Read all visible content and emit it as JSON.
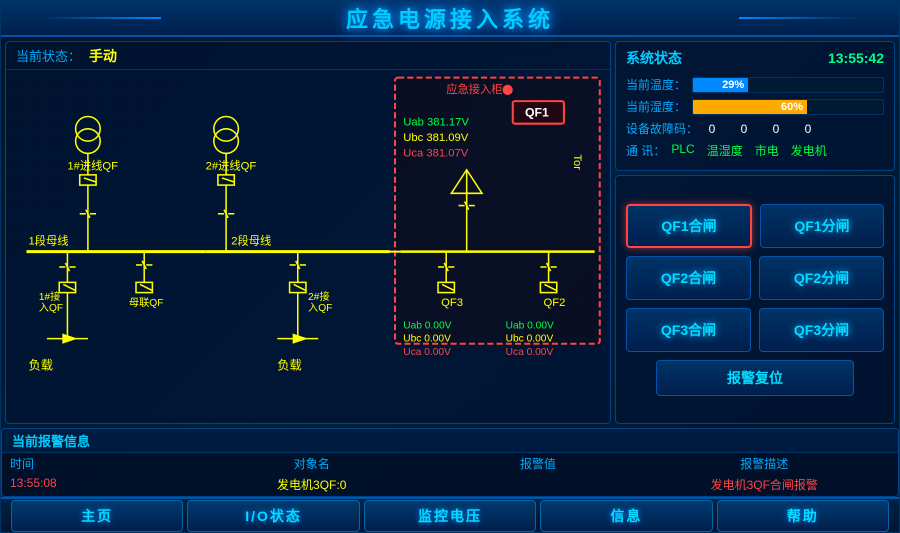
{
  "header": {
    "title": "应急电源接入系统"
  },
  "status": {
    "label": "当前状态：",
    "value": "手动",
    "time": "13:55:42"
  },
  "system_status": {
    "title": "系统状态",
    "temperature_label": "当前温度：",
    "temperature_value": "29%",
    "temperature_pct": 29,
    "humidity_label": "当前湿度：",
    "humidity_value": "60%",
    "humidity_pct": 60,
    "fault_label": "设备故障码：",
    "fault_values": [
      "0",
      "0",
      "0",
      "0"
    ],
    "comm_label": "通  讯：",
    "comm_items": [
      "PLC",
      "温湿度",
      "市电",
      "发电机"
    ]
  },
  "emergency_box": {
    "label": "应急接入柜",
    "voltage1_label": "Uab",
    "voltage1_value": "381.17V",
    "voltage2_label": "Ubc",
    "voltage2_value": "381.09V",
    "voltage3_label": "Uca",
    "voltage3_value": "381.07V",
    "qf1_label": "QF1"
  },
  "diagram": {
    "qf1_label": "1#进线QF",
    "qf2_label": "2#进线QF",
    "bus1_label": "1段母线",
    "bus2_label": "2段母线",
    "feed1_label": "1#接\n入QF",
    "feed2_label": "2#接\n入QF",
    "tie_label": "母联QF",
    "load1_label": "负载",
    "load2_label": "负载",
    "qf3_label": "QF3",
    "qf2r_label": "QF2",
    "volt1_ab": "Uab  0.00V",
    "volt1_bc": "Ubc  0.00V",
    "volt1_ca": "Uca  0.00V",
    "volt2_ab": "Uab  0.00V",
    "volt2_bc": "Ubc  0.00V",
    "volt2_ca": "Uca  0.00V",
    "tor_label": "Tor"
  },
  "controls": {
    "qf1_close": "QF1合闸",
    "qf1_open": "QF1分闸",
    "qf2_close": "QF2合闸",
    "qf2_open": "QF2分闸",
    "qf3_close": "QF3合闸",
    "qf3_open": "QF3分闸",
    "alarm_reset": "报警复位"
  },
  "alarm": {
    "title": "当前报警信息",
    "col_time": "时间",
    "col_object": "对象名",
    "col_value": "报警值",
    "col_desc": "报警描述",
    "row": {
      "time": "13:55:08",
      "object": "发电机3QF:0",
      "value": "",
      "desc": "发电机3QF合闸报警"
    }
  },
  "nav": {
    "home": "主页",
    "io": "I/O状态",
    "monitor": "监控电压",
    "info": "信息",
    "help": "帮助"
  }
}
